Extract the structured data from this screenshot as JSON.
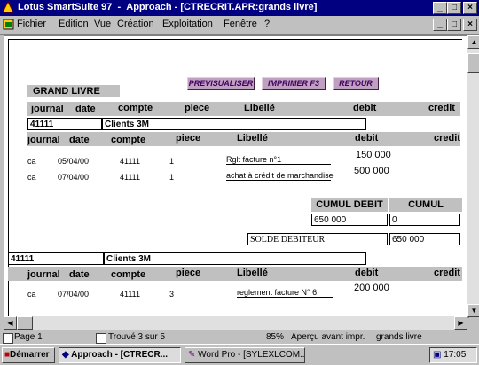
{
  "window": {
    "app_name": "Lotus SmartSuite 97",
    "title": "Approach - [CTRECRIT.APR:grands livre]",
    "min": "_",
    "max": "□",
    "close": "×"
  },
  "menu": [
    "Fichier",
    "Edition",
    "Vue",
    "Création",
    "Exploitation",
    "Fenêtre",
    "?"
  ],
  "report": {
    "title": "GRAND LIVRE",
    "buttons": {
      "preview": "PREVISUALISER",
      "print": "IMPRIMER F3",
      "back": "RETOUR"
    },
    "col_headers": {
      "journal": "journal",
      "date": "date",
      "compte": "compte",
      "piece": "piece",
      "libelle": "Libellé",
      "debit": "debit",
      "credit": "credit"
    },
    "account1": {
      "code": "41111",
      "name": "Clients 3M",
      "rows": [
        {
          "journal": "ca",
          "date": "05/04/00",
          "compte": "41111",
          "piece": "1",
          "libelle": "Rglt facture n°1",
          "debit": "150 000",
          "credit": ""
        },
        {
          "journal": "ca",
          "date": "07/04/00",
          "compte": "41111",
          "piece": "1",
          "libelle": "achat à crédit de marchandise",
          "debit": "500 000",
          "credit": ""
        }
      ],
      "cumul_debit_label": "CUMUL DEBIT",
      "cumul_credit_label": "CUMUL CREDIT",
      "cumul_debit": "650 000",
      "cumul_credit": "0",
      "solde_label": "SOLDE DEBITEUR",
      "solde": "650 000"
    },
    "account2": {
      "code": "41111",
      "name": "Clients 3M",
      "rows": [
        {
          "journal": "ca",
          "date": "07/04/00",
          "compte": "41111",
          "piece": "3",
          "libelle": "reglement facture N° 6",
          "debit": "200 000",
          "credit": ""
        }
      ]
    }
  },
  "status": {
    "page": "Page 1",
    "found": "Trouvé 3 sur 5",
    "zoom": "85%",
    "mode": "Aperçu avant impr.",
    "view": "grands livre"
  },
  "taskbar": {
    "start": "Démarrer",
    "task1": "Approach - [CTRECR...",
    "task2": "Word Pro - [SYLEXLCOM...",
    "clock": "17:05"
  },
  "colors": {
    "titlebar": "#000080",
    "face": "#c0c0c0",
    "button_purple": "#c0a0c0"
  }
}
